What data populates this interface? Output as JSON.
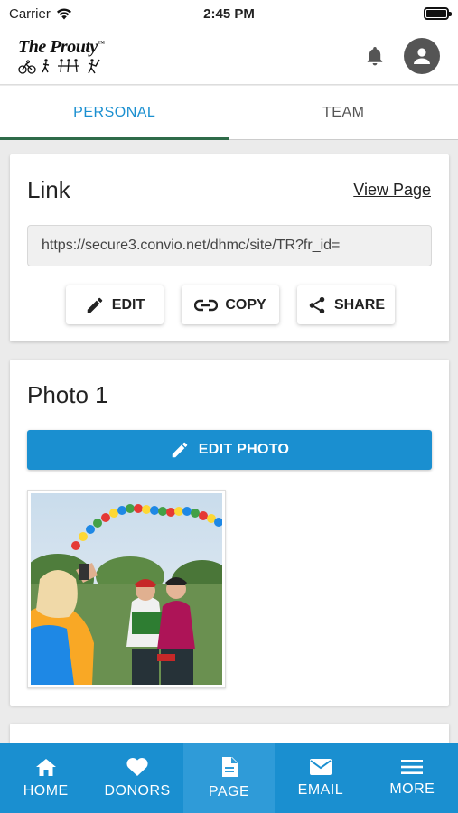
{
  "status_bar": {
    "carrier": "Carrier",
    "time": "2:45 PM"
  },
  "header": {
    "logo_text": "The Prouty",
    "logo_trademark": "™"
  },
  "tabs": [
    {
      "label": "PERSONAL",
      "active": true
    },
    {
      "label": "TEAM",
      "active": false
    }
  ],
  "link_card": {
    "title": "Link",
    "view_page": "View Page",
    "url": "https://secure3.convio.net/dhmc/site/TR?fr_id=",
    "buttons": {
      "edit": "EDIT",
      "copy": "COPY",
      "share": "SHARE"
    }
  },
  "photo_card": {
    "title": "Photo 1",
    "edit_photo": "EDIT PHOTO"
  },
  "bottom_nav": [
    {
      "label": "HOME",
      "icon": "home-icon"
    },
    {
      "label": "DONORS",
      "icon": "heart-icon"
    },
    {
      "label": "PAGE",
      "icon": "page-icon",
      "active": true
    },
    {
      "label": "EMAIL",
      "icon": "mail-icon"
    },
    {
      "label": "MORE",
      "icon": "menu-icon"
    }
  ],
  "colors": {
    "accent": "#1a8fd0",
    "tab_underline": "#2f6b49"
  }
}
